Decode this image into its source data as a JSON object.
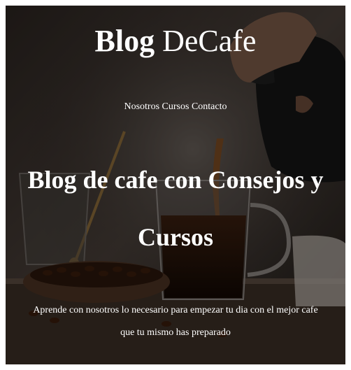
{
  "header": {
    "title_bold": "Blog",
    "title_regular": "DeCafe"
  },
  "nav": {
    "items": [
      "Nosotros",
      "Cursos",
      "Contacto"
    ]
  },
  "hero": {
    "headline": "Blog de cafe con Consejos y Cursos",
    "tagline": "Aprende con nosotros lo necesario para empezar tu dia con el mejor cafe que tu mismo has preparado"
  },
  "colors": {
    "text": "#ffffff",
    "overlay": "#000000"
  }
}
